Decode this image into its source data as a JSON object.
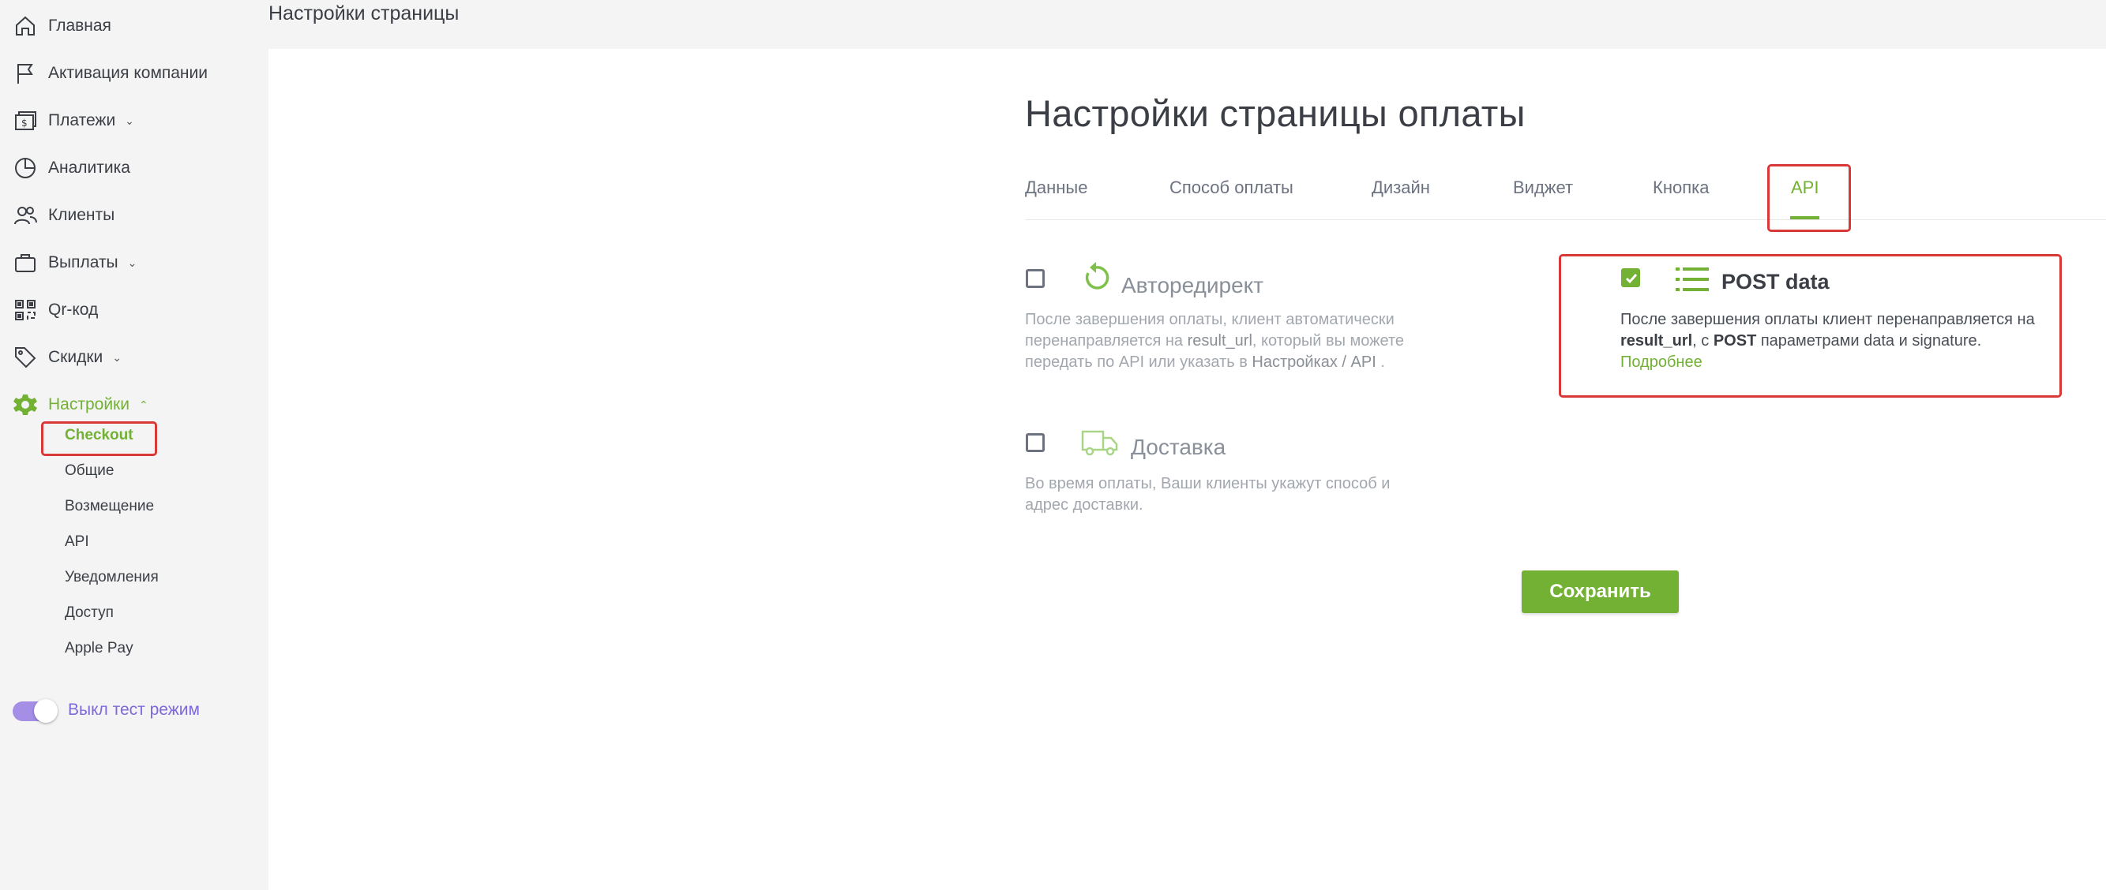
{
  "header": {
    "title": "Настройки страницы"
  },
  "sidebar": {
    "items": [
      {
        "label": "Главная",
        "icon": "home-icon"
      },
      {
        "label": "Активация компании",
        "icon": "flag-icon"
      },
      {
        "label": "Платежи",
        "icon": "payments-icon",
        "chevron": "down"
      },
      {
        "label": "Аналитика",
        "icon": "analytics-icon"
      },
      {
        "label": "Клиенты",
        "icon": "users-icon"
      },
      {
        "label": "Выплаты",
        "icon": "briefcase-icon",
        "chevron": "down"
      },
      {
        "label": "Qr-код",
        "icon": "qr-code-icon"
      },
      {
        "label": "Скидки",
        "icon": "tag-icon",
        "chevron": "down"
      },
      {
        "label": "Настройки",
        "icon": "gear-icon",
        "chevron": "up",
        "active": true
      }
    ],
    "subitems": [
      "Checkout",
      "Общие",
      "Возмещение",
      "API",
      "Уведомления",
      "Доступ",
      "Apple Pay"
    ],
    "test_mode_label": "Выкл тест режим"
  },
  "main": {
    "heading": "Настройки страницы оплаты",
    "tabs": [
      "Данные",
      "Способ оплаты",
      "Дизайн",
      "Виджет",
      "Кнопка",
      "API"
    ],
    "active_tab": "API",
    "options": {
      "autoredirect": {
        "title": "Авторедирект",
        "desc_1": "После завершения оплаты, клиент автоматически перенаправляется на ",
        "desc_kw1": "result_url",
        "desc_2": ", который вы можете передать по API или указать в ",
        "desc_kw2": "Настройках / API",
        "desc_3": " .",
        "checked": false
      },
      "delivery": {
        "title": "Доставка",
        "desc": "Во время оплаты, Ваши клиенты укажут способ и адрес доставки.",
        "checked": false
      },
      "post_data": {
        "title": "POST data",
        "desc_1": "После завершения оплаты клиент перенаправляется на ",
        "desc_kw1": "result_url",
        "desc_2": ", с ",
        "desc_kw2": "POST",
        "desc_3": " параметрами data и signature.",
        "link": "Подробнее",
        "checked": true
      }
    },
    "save_label": "Сохранить"
  },
  "colors": {
    "accent": "#72b133",
    "highlight": "#d93838",
    "toggle": "#a48ee6"
  }
}
